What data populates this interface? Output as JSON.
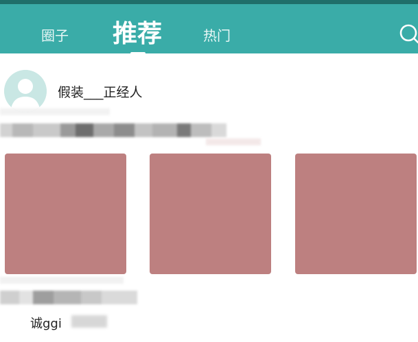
{
  "header": {
    "tabs": [
      {
        "label": "圈子",
        "active": false
      },
      {
        "label": "推荐",
        "active": true
      },
      {
        "label": "热门",
        "active": false
      }
    ],
    "search_icon": "search-icon",
    "background_color": "#3aaca8"
  },
  "post": {
    "author": "假装___正经人",
    "avatar_icon": "user-placeholder-icon",
    "image_count": 3,
    "image_placeholder_color": "#bd8080",
    "commenter": "诚ggi"
  }
}
